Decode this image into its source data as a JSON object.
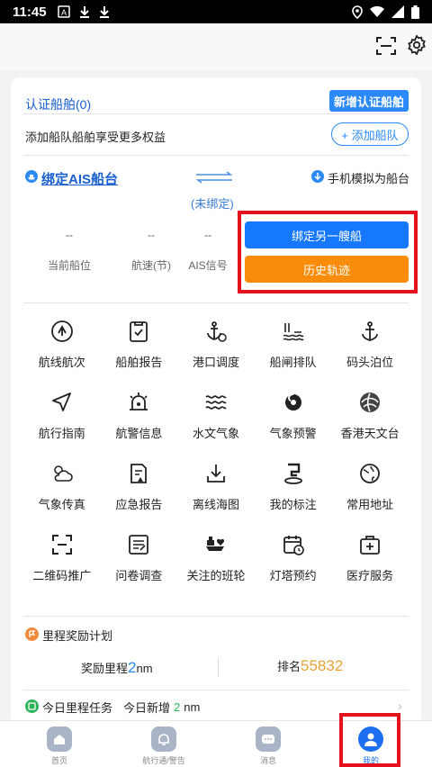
{
  "status": {
    "time": "11:45"
  },
  "header": {
    "scan_icon": "scan-icon",
    "settings_icon": "gear-icon"
  },
  "certified": {
    "title": "认证船舶(0)",
    "new_button": "新增认证船舶",
    "fleet_hint": "添加船队船舶享受更多权益",
    "add_fleet_button": "+ 添加船队"
  },
  "ais": {
    "bind_label": "绑定AIS船台",
    "unbound": "(未绑定)",
    "phone_sim": "手机模拟为船台",
    "stats": [
      {
        "value": "--",
        "label": "当前船位"
      },
      {
        "value": "--",
        "label": "航速(节)"
      },
      {
        "value": "--",
        "label": "AIS信号"
      }
    ],
    "bind_other_button": "绑定另一艘船",
    "history_button": "历史轨迹"
  },
  "grid": [
    {
      "label": "航线航次",
      "icon": "route-icon"
    },
    {
      "label": "船舶报告",
      "icon": "report-icon"
    },
    {
      "label": "港口调度",
      "icon": "anchor-dispatch-icon"
    },
    {
      "label": "船闸排队",
      "icon": "lock-queue-icon"
    },
    {
      "label": "码头泊位",
      "icon": "anchor-icon"
    },
    {
      "label": "航行指南",
      "icon": "navigate-icon"
    },
    {
      "label": "航警信息",
      "icon": "alarm-icon"
    },
    {
      "label": "水文气象",
      "icon": "waves-icon"
    },
    {
      "label": "气象预警",
      "icon": "typhoon-icon"
    },
    {
      "label": "香港天文台",
      "icon": "observatory-icon"
    },
    {
      "label": "气象传真",
      "icon": "weather-icon"
    },
    {
      "label": "应急报告",
      "icon": "emergency-report-icon"
    },
    {
      "label": "离线海图",
      "icon": "download-icon"
    },
    {
      "label": "我的标注",
      "icon": "marker-icon"
    },
    {
      "label": "常用地址",
      "icon": "address-icon"
    },
    {
      "label": "二维码推广",
      "icon": "qrcode-icon"
    },
    {
      "label": "问卷调查",
      "icon": "survey-icon"
    },
    {
      "label": "关注的班轮",
      "icon": "liner-icon"
    },
    {
      "label": "灯塔预约",
      "icon": "calendar-icon"
    },
    {
      "label": "医疗服务",
      "icon": "medical-icon"
    }
  ],
  "mileage": {
    "title": "里程奖励计划",
    "reward_label": "奖励里程",
    "reward_value": "2",
    "reward_unit": "nm",
    "rank_label": "排名",
    "rank_value": "55832"
  },
  "task": {
    "title": "今日里程任务",
    "new_label": "今日新增",
    "new_value": "2",
    "new_unit": "nm"
  },
  "tabs": [
    {
      "label": "首页"
    },
    {
      "label": "航行通/警告"
    },
    {
      "label": "消息"
    },
    {
      "label": "我的"
    }
  ],
  "colors": {
    "accent": "#1677ff",
    "orange": "#fa8c0c",
    "highlight": "#e5121e"
  }
}
